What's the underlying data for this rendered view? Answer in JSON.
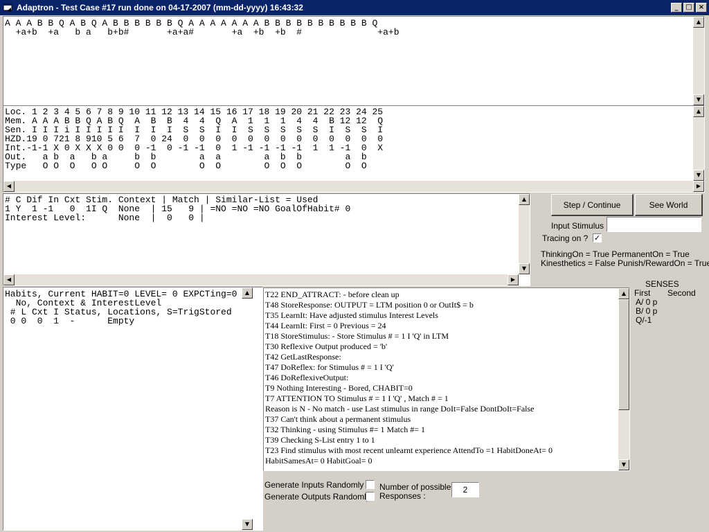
{
  "window": {
    "title": "Adaptron - Test Case #17 run done on 04-17-2007 (mm-dd-yyyy) 16:43:32",
    "minimize_glyph": "_",
    "maximize_glyph": "□",
    "close_glyph": "×",
    "icon": "app-icon"
  },
  "sequence_panel": {
    "lines": [
      "A A A B B Q A B Q A B B B B B B Q A A A A A A A B B B B B B B B B B Q",
      "  +a+b  +a   b a   b+b#       +a+a#       +a  +b  +b  #              +a+b"
    ]
  },
  "memory_table": {
    "rows": [
      "Loc. 1 2 3 4 5 6 7 8 9 10 11 12 13 14 15 16 17 18 19 20 21 22 23 24 25",
      "Mem. A A A B B Q A B Q  A  B  B  4  4  Q  A  1  1  1  4  4  B 12 12  Q",
      "Sen. I I I i I I I I I  I  I  I  S  S  I  I  S  S  S  S  S  I  S  S  I",
      "HZD.19 0 721 8 910 5 6  7  0 24  0  0  0  0  0  0  0  0  0  0  0  0  0",
      "Int.-1-1 X 0 X X X 0 0  0 -1  0 -1 -1  0  1 -1 -1 -1 -1  1  1 -1  0  X",
      "Out.   a b  a   b a     b  b        a  a        a  b  b        a  b",
      "Type   O O  O   O O     O  O        O  O        O  O  O        O  O"
    ]
  },
  "stimulus_panel": {
    "lines": [
      "# C Dif In Cxt Stim. Context | Match | Similar-List = Used",
      "1 Y  1 -1   0  1I Q  None  | 15   9 | =NO =NO =NO GoalOfHabit# 0",
      "Interest Level:      None  |  0   0 |"
    ]
  },
  "controls": {
    "step_button": "Step / Continue",
    "world_button": "See World",
    "input_stimulus_label": "Input Stimulus :",
    "input_stimulus_value": "",
    "tracing_label": "Tracing on ?",
    "tracing_checked": "✓",
    "status_line1": "ThinkingOn = True   PermanentOn = True",
    "status_line2": "Kinesthetics = False   Punish/RewardOn = True"
  },
  "habits_panel": {
    "lines": [
      "Habits, Current HABIT=0 LEVEL= 0 EXPCTing=0",
      "  No, Context & InterestLevel",
      " # L Cxt I Status, Locations, S=TrigStored",
      " 0 0  0  1  -      Empty"
    ]
  },
  "trace_panel": {
    "lines": [
      "T22 END_ATTRACT: - before clean up",
      "T48 StoreResponse: OUTPUT = LTM position  0  or  OutIt$ = b",
      "T35 LearnIt: Have adjusted stimulus Interest Levels",
      "T44 LearnIt: First =  0 Previous =  24",
      "T18 StoreStimulus: - Store Stimulus # = 1 I 'Q'  in LTM",
      "T30 Reflexive Output produced = 'b'",
      "T42 GetLastResponse:",
      "T47 DoReflex: for Stimulus # = 1 I 'Q'",
      "T46 DoReflexiveOutput:",
      "T9   Nothing Interesting - Bored, CHABIT=0",
      "T7   ATTENTION TO  Stimulus # = 1 I 'Q' , Match # = 1",
      "  Reason is N - No match - use Last stimulus in range  DoIt=False DontDoIt=False",
      "T37 Can't think about a permanent stimulus",
      "T32 Thinking - using Stimulus #= 1 Match #= 1",
      "T39 Checking S-List entry 1 to  1",
      "T23 Find stimulus with most recent unlearnt experience  AttendTo =1 HabitDoneAt= 0",
      "HabitSamesAt= 0 HabitGoal= 0"
    ]
  },
  "senses": {
    "title": "SENSES",
    "first_label": "First",
    "second_label": "Second",
    "items": [
      "A/ 0 p",
      "B/ 0 p",
      "Q/-1"
    ]
  },
  "random_options": {
    "inputs_label": "Generate Inputs Randomly ?",
    "outputs_label": "Generate Outputs Randomly?",
    "responses_label_1": "Number of possible",
    "responses_label_2": "Responses :",
    "responses_value": "2"
  },
  "scroll_glyphs": {
    "up": "▲",
    "down": "▼",
    "left": "◀",
    "right": "▶"
  }
}
